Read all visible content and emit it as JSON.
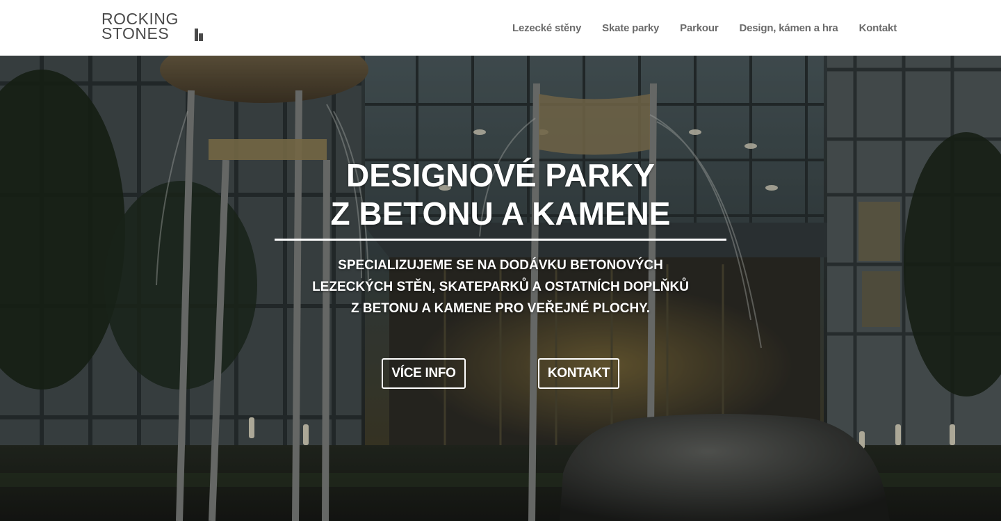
{
  "brand": {
    "line1": "ROCKING",
    "line2": "STONES",
    "color": "#4a4a4a"
  },
  "nav": {
    "items": [
      {
        "label": "Lezecké stěny"
      },
      {
        "label": "Skate parky"
      },
      {
        "label": "Parkour"
      },
      {
        "label": "Design, kámen a hra"
      },
      {
        "label": "Kontakt"
      }
    ],
    "color": "#6b6b6b"
  },
  "hero": {
    "title_line1": "DESIGNOVÉ PARKY",
    "title_line2": "Z BETONU A KAMENE",
    "subtitle_line1": "SPECIALIZUJEME SE NA DODÁVKU BETONOVÝCH",
    "subtitle_line2": "LEZECKÝCH STĚN, SKATEPARKŮ A OSTATNÍCH DOPLŇKŮ",
    "subtitle_line3": "Z BETONU A KAMENE PRO VEŘEJNÉ PLOCHY.",
    "buttons": {
      "info": "VÍCE INFO",
      "contact": "KONTAKT"
    }
  }
}
